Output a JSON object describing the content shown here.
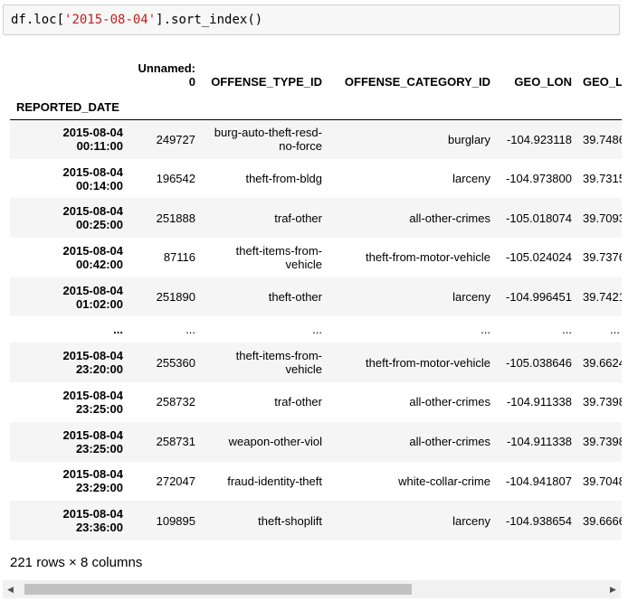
{
  "code_cell": {
    "prefix": "df.loc[",
    "string_arg": "'2015-08-04'",
    "suffix": "].sort_index()"
  },
  "table": {
    "columns": [
      "Unnamed: 0",
      "OFFENSE_TYPE_ID",
      "OFFENSE_CATEGORY_ID",
      "GEO_LON",
      "GEO_L"
    ],
    "index_name": "REPORTED_DATE",
    "rows": [
      {
        "index": "2015-08-04 00:11:00",
        "cells": [
          "249727",
          "burg-auto-theft-resd-no-force",
          "burglary",
          "-104.923118",
          "39.7486"
        ]
      },
      {
        "index": "2015-08-04 00:14:00",
        "cells": [
          "196542",
          "theft-from-bldg",
          "larceny",
          "-104.973800",
          "39.7315"
        ]
      },
      {
        "index": "2015-08-04 00:25:00",
        "cells": [
          "251888",
          "traf-other",
          "all-other-crimes",
          "-105.018074",
          "39.7093"
        ]
      },
      {
        "index": "2015-08-04 00:42:00",
        "cells": [
          "87116",
          "theft-items-from-vehicle",
          "theft-from-motor-vehicle",
          "-105.024024",
          "39.7376"
        ]
      },
      {
        "index": "2015-08-04 01:02:00",
        "cells": [
          "251890",
          "theft-other",
          "larceny",
          "-104.996451",
          "39.7421"
        ]
      },
      {
        "index": "...",
        "cells": [
          "...",
          "...",
          "...",
          "...",
          "..."
        ],
        "ellipsis": true
      },
      {
        "index": "2015-08-04 23:20:00",
        "cells": [
          "255360",
          "theft-items-from-vehicle",
          "theft-from-motor-vehicle",
          "-105.038646",
          "39.6624"
        ]
      },
      {
        "index": "2015-08-04 23:25:00",
        "cells": [
          "258732",
          "traf-other",
          "all-other-crimes",
          "-104.911338",
          "39.7398"
        ]
      },
      {
        "index": "2015-08-04 23:25:00",
        "cells": [
          "258731",
          "weapon-other-viol",
          "all-other-crimes",
          "-104.911338",
          "39.7398"
        ]
      },
      {
        "index": "2015-08-04 23:29:00",
        "cells": [
          "272047",
          "fraud-identity-theft",
          "white-collar-crime",
          "-104.941807",
          "39.7048"
        ]
      },
      {
        "index": "2015-08-04 23:36:00",
        "cells": [
          "109895",
          "theft-shoplift",
          "larceny",
          "-104.938654",
          "39.6666"
        ]
      }
    ]
  },
  "shape_text": "221 rows × 8 columns",
  "scrollbar": {
    "left_arrow_icon": "triangle-left-icon",
    "right_arrow_icon": "triangle-right-icon"
  }
}
